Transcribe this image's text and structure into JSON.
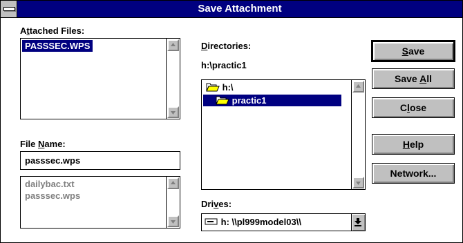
{
  "window": {
    "title": "Save Attachment"
  },
  "attached_files": {
    "label_pre": "A",
    "label_key": "t",
    "label_post": "tached Files:",
    "items": [
      {
        "label": "PASSSEC.WPS",
        "selected": true
      }
    ]
  },
  "file_name": {
    "label_pre": "File ",
    "label_key": "N",
    "label_post": "ame:",
    "value": "passsec.wps",
    "list": [
      "dailybac.txt",
      "passsec.wps"
    ]
  },
  "directories": {
    "label_pre": "",
    "label_key": "D",
    "label_post": "irectories:",
    "current_path": "h:\\practic1",
    "items": [
      {
        "label": "h:\\",
        "icon": "open-folder-icon",
        "selected": false
      },
      {
        "label": "practic1",
        "icon": "open-folder-icon",
        "selected": true
      }
    ]
  },
  "drives": {
    "label_pre": "Dri",
    "label_key": "v",
    "label_post": "es:",
    "value": "h: \\\\pl999model03\\\\",
    "icon": "network-drive-icon"
  },
  "buttons": {
    "save": {
      "pre": "",
      "key": "S",
      "post": "ave"
    },
    "save_all": {
      "pre": "Save ",
      "key": "A",
      "post": "ll"
    },
    "close": {
      "pre": "C",
      "key": "l",
      "post": "ose"
    },
    "help": {
      "pre": "",
      "key": "H",
      "post": "elp"
    },
    "network": {
      "label": "Network..."
    }
  },
  "colors": {
    "title_bar": "#000080",
    "selection": "#000080",
    "button_face": "#c0c0c0",
    "disabled_text": "#808080"
  }
}
